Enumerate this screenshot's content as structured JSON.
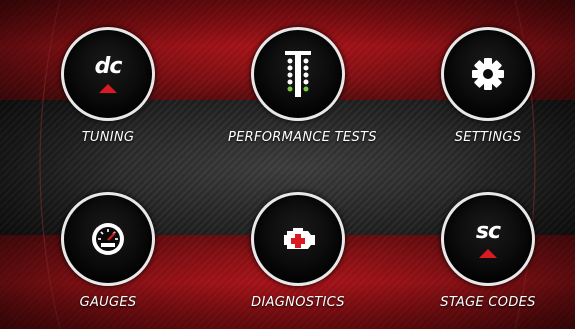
{
  "menu": {
    "items": [
      {
        "label": "TUNING",
        "icon": "dc-logo-icon",
        "logo_text": "dc"
      },
      {
        "label": "PERFORMANCE TESTS",
        "icon": "drag-tree-icon"
      },
      {
        "label": "SETTINGS",
        "icon": "gear-icon"
      },
      {
        "label": "GAUGES",
        "icon": "speedometer-icon"
      },
      {
        "label": "DIAGNOSTICS",
        "icon": "check-engine-icon"
      },
      {
        "label": "STAGE CODES",
        "icon": "sc-logo-icon",
        "logo_text": "sc"
      }
    ]
  },
  "colors": {
    "accent": "#c0151b",
    "ring": "#e8e8e8",
    "lights_green": "#7ac943"
  }
}
